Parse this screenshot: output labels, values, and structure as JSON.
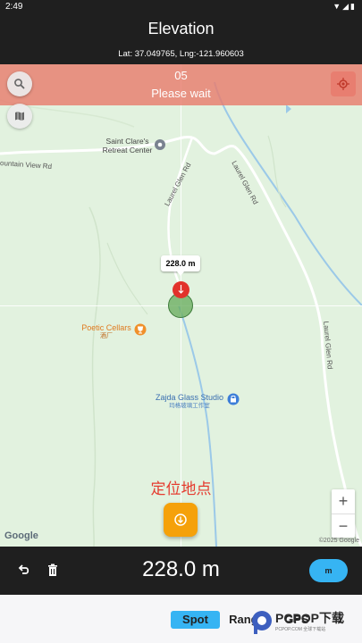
{
  "status_bar": {
    "time": "2:49"
  },
  "header": {
    "title": "Elevation",
    "coords": "Lat: 37.049765, Lng:-121.960603"
  },
  "banner": {
    "count": "05",
    "message": "Please wait"
  },
  "map": {
    "poi": [
      {
        "name": "Saint Clare's Retreat Center"
      },
      {
        "name": "Poetic Cellars",
        "sub": "酒厂"
      },
      {
        "name": "Zajda Glass Studio",
        "sub": "玛格玻璃工作室"
      }
    ],
    "roads": [
      "ountain View Rd",
      "Laurel Glen Rd",
      "Laurel Glen Rd",
      "Laurel Glen Rd"
    ],
    "elevation_tag": "228.0 m",
    "confirm_text": "定位地点",
    "zoom_in": "+",
    "zoom_out": "−",
    "google_logo": "Google",
    "copyright": "©2025 Google"
  },
  "bottom_bar": {
    "elevation": "228.0 m",
    "unit": "m"
  },
  "modes": {
    "tabs": [
      "Spot",
      "Range",
      "GPS"
    ],
    "active": "Spot",
    "more": "⋮"
  },
  "watermark": {
    "text": "PCPOP下载",
    "sub": "PCPOP.COM 全球下载站"
  },
  "colors": {
    "accent": "#36b4f3",
    "banner": "#e87c6e",
    "fab": "#f5a10a",
    "bar": "#1f1f1f"
  }
}
